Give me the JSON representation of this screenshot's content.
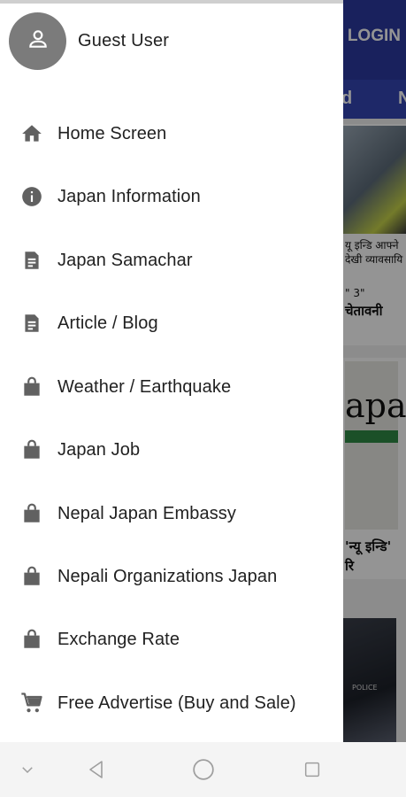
{
  "background": {
    "login_label": "LOGIN",
    "tab_fragment_1": "d",
    "tab_fragment_2": "N",
    "news_line_1": "यू इन्डि आफ्ने",
    "news_line_2": "देखी व्यावसायि",
    "news_line_3": "\" 3\"",
    "news_line_4": "चेतावनी",
    "news_card_word": "apa",
    "news_line_5": "'न्यू इन्डि'",
    "news_line_6": "रि",
    "police_label": "POLICE",
    "colors": {
      "appbar": "#2b3aa0"
    }
  },
  "drawer": {
    "user": {
      "name": "Guest User",
      "avatar_icon": "person-icon"
    },
    "menu": [
      {
        "label": "Home Screen",
        "icon": "home-icon"
      },
      {
        "label": "Japan Information",
        "icon": "info-icon"
      },
      {
        "label": "Japan Samachar",
        "icon": "document-icon"
      },
      {
        "label": "Article / Blog",
        "icon": "document-icon"
      },
      {
        "label": "Weather / Earthquake",
        "icon": "shopping-bag-icon"
      },
      {
        "label": "Japan Job",
        "icon": "shopping-bag-icon"
      },
      {
        "label": "Nepal Japan Embassy",
        "icon": "shopping-bag-icon"
      },
      {
        "label": "Nepali Organizations Japan",
        "icon": "shopping-bag-icon"
      },
      {
        "label": "Exchange Rate",
        "icon": "shopping-bag-icon"
      },
      {
        "label": "Free Advertise (Buy and Sale)",
        "icon": "cart-icon"
      }
    ]
  },
  "navbar": {
    "buttons": [
      "chevron-down-icon",
      "back-icon",
      "home-circle-icon",
      "recents-icon"
    ]
  }
}
